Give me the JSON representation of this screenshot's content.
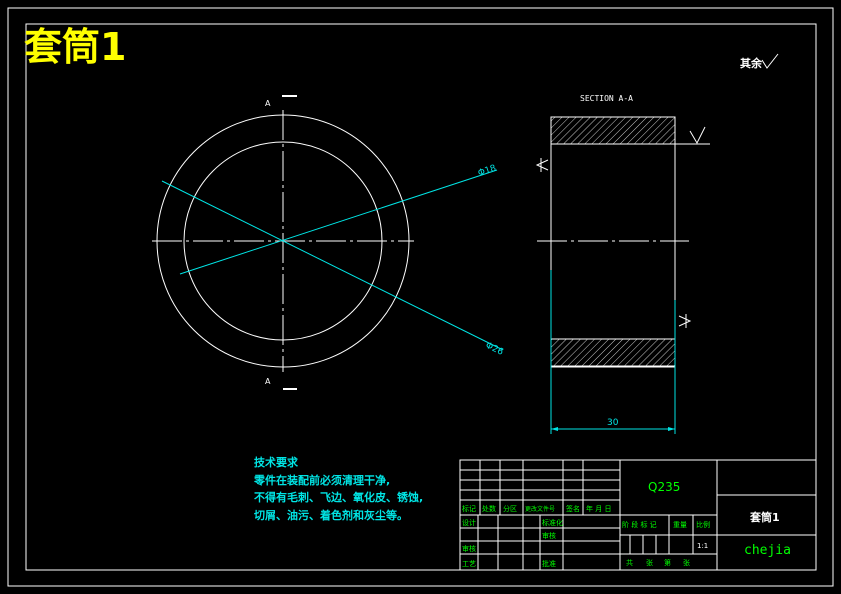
{
  "title": "套筒1",
  "roughness_note": "其余",
  "section_label": "SECTION A-A",
  "section_marks": [
    "A",
    "A"
  ],
  "dimensions": {
    "inner_dia": "Φ18",
    "outer_dia": "Φ26",
    "length": "30"
  },
  "tech_requirements": {
    "heading": "技术要求",
    "lines": [
      "零件在装配前必须清理干净,",
      "不得有毛刺、飞边、氧化皮、锈蚀,",
      "切屑、油污、着色剂和灰尘等。"
    ]
  },
  "title_block": {
    "material": "Q235",
    "part_name": "套筒1",
    "designer": "chejia",
    "scale": "1:1",
    "header_row": [
      "标记",
      "处数",
      "分区",
      "更改文件号",
      "签名",
      "年 月 日"
    ],
    "left_labels": [
      "设计",
      "审核",
      "工艺"
    ],
    "mid_labels": [
      "标准化",
      "审核",
      "批准"
    ],
    "stage_labels": [
      "阶 段 标 记",
      "重量",
      "比例"
    ],
    "footer": [
      "共",
      "张",
      "第",
      "张"
    ]
  }
}
